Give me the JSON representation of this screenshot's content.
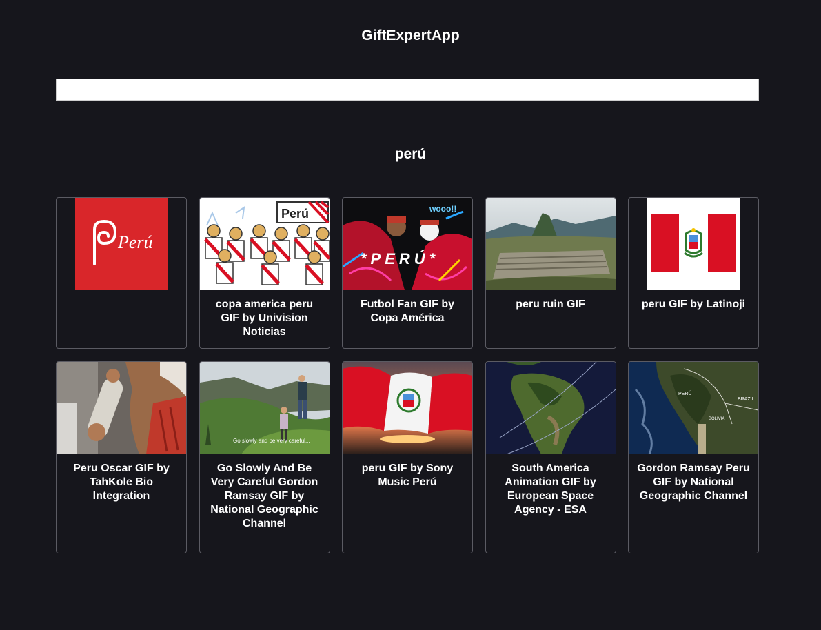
{
  "app": {
    "title": "GiftExpertApp"
  },
  "search": {
    "value": "",
    "placeholder": ""
  },
  "category": {
    "title": "perú"
  },
  "gifs": [
    {
      "title": "",
      "icon": "peru-brand-logo-image"
    },
    {
      "title": "copa america peru GIF by Univision Noticias",
      "icon": "cartoon-fans-image"
    },
    {
      "title": "Futbol Fan GIF by Copa América",
      "icon": "football-fans-image"
    },
    {
      "title": "peru ruin GIF",
      "icon": "machu-picchu-image"
    },
    {
      "title": "peru GIF by Latinoji",
      "icon": "peru-flag-image"
    },
    {
      "title": "Peru Oscar GIF by TahKole Bio Integration",
      "icon": "musician-image"
    },
    {
      "title": "Go Slowly And Be Very Careful Gordon Ramsay GIF by National Geographic Channel",
      "icon": "hikers-image"
    },
    {
      "title": "peru GIF by Sony Music Perú",
      "icon": "waving-flag-image"
    },
    {
      "title": "South America Animation GIF by European Space Agency - ESA",
      "icon": "satellite-map-image"
    },
    {
      "title": "Gordon Ramsay Peru GIF by National Geographic Channel",
      "icon": "peru-map-image"
    }
  ],
  "image_text": {
    "peru_logo": "Perú",
    "cartoon_banner": "Perú",
    "fans_banner": "*PERÚ*",
    "fans_shout": "wooo!!",
    "hikers_caption": "Go slowly and be very careful...",
    "map_label_peru": "PERÚ",
    "map_label_brazil": "BRAZIL",
    "map_label_bolivia": "BOLIVIA"
  },
  "colors": {
    "background": "#16161c",
    "card_border": "#5b5b63",
    "peru_red": "#d91023"
  }
}
